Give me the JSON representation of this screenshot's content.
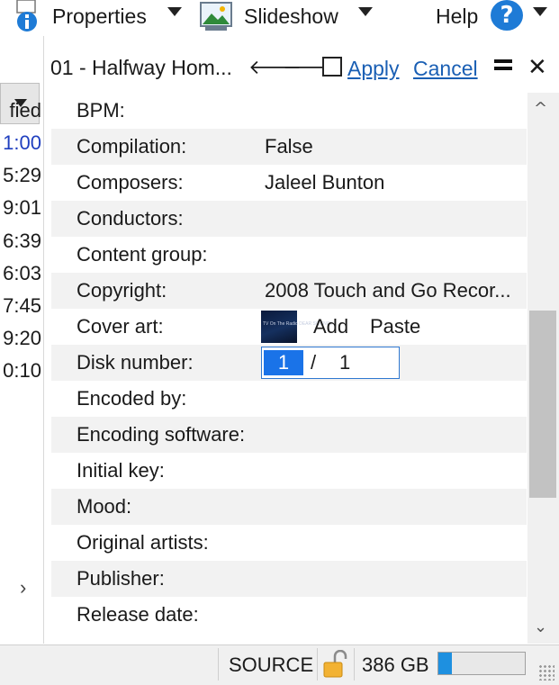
{
  "menu": {
    "properties_label": "Properties",
    "slideshow_label": "Slideshow",
    "help_label": "Help",
    "help_icon": "?"
  },
  "left_pane": {
    "header_label": "fied",
    "durations": [
      "1:00",
      "5:29",
      "9:01",
      "6:39",
      "6:03",
      "7:45",
      "9:20",
      "0:10"
    ],
    "selected_index": 0,
    "expand_glyph": "›"
  },
  "editor": {
    "title": "01 - Halfway Hom...",
    "prev_glyph": "🡐",
    "next_glyph": "🡒",
    "apply_label": "Apply",
    "cancel_label": "Cancel",
    "close_glyph": "✕"
  },
  "properties": [
    {
      "key": "BPM:",
      "value": ""
    },
    {
      "key": "Compilation:",
      "value": "False"
    },
    {
      "key": "Composers:",
      "value": "Jaleel Bunton"
    },
    {
      "key": "Conductors:",
      "value": ""
    },
    {
      "key": "Content group:",
      "value": ""
    },
    {
      "key": "Copyright:",
      "value": "2008 Touch and Go Recor..."
    },
    {
      "key": "Cover art:",
      "value": ""
    },
    {
      "key": "Disk number:",
      "value": ""
    },
    {
      "key": "Encoded by:",
      "value": ""
    },
    {
      "key": "Encoding software:",
      "value": ""
    },
    {
      "key": "Initial key:",
      "value": ""
    },
    {
      "key": "Mood:",
      "value": ""
    },
    {
      "key": "Original artists:",
      "value": ""
    },
    {
      "key": "Publisher:",
      "value": ""
    },
    {
      "key": "Release date:",
      "value": ""
    }
  ],
  "cover_art": {
    "thumb_text": "TV On The Radio  DEAR SCIENCE",
    "add_label": "Add",
    "paste_label": "Paste"
  },
  "disk_number": {
    "current": "1",
    "separator": "/",
    "total": "1"
  },
  "scrollbar": {
    "up_glyph": "^",
    "down_glyph": "⌄"
  },
  "status": {
    "source_label": "SOURCE",
    "free_space": "386 GB",
    "disk_used_fraction": 0.16
  },
  "colors": {
    "accent": "#1a73e8",
    "link": "#1a5fb4",
    "selected_duration": "#1f3fbf"
  }
}
